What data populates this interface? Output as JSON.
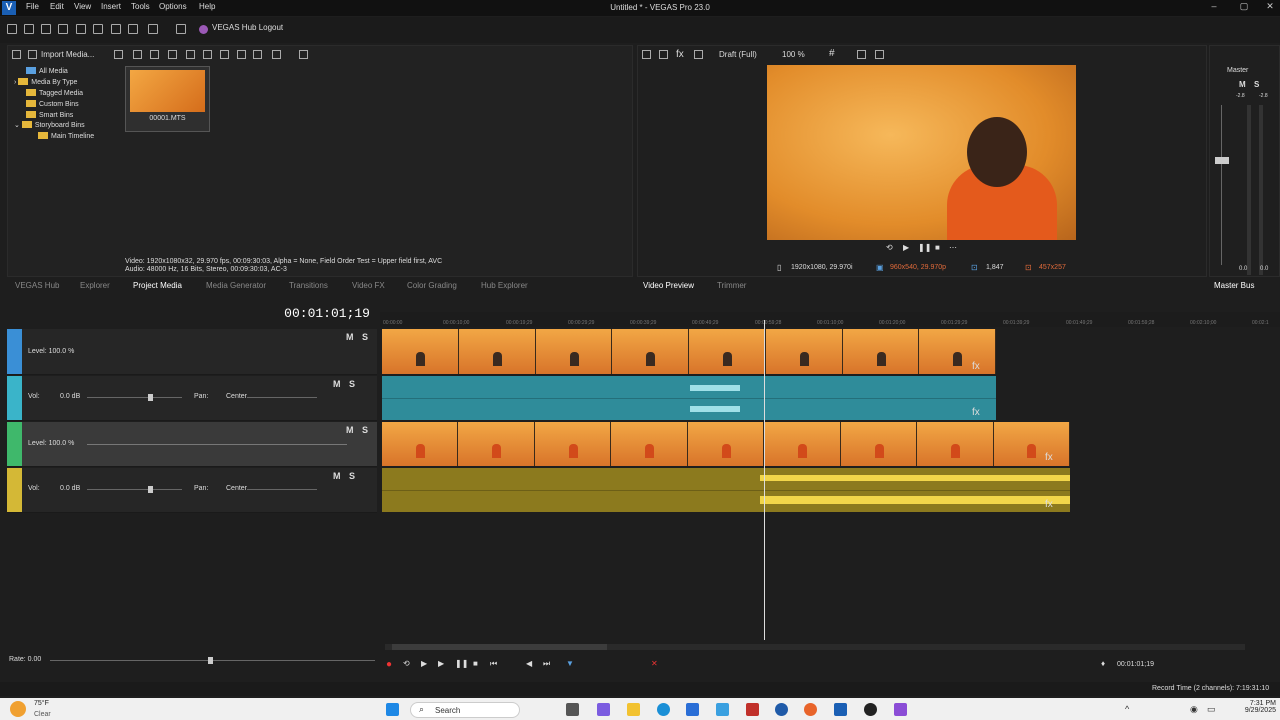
{
  "app": {
    "title": "Untitled * - VEGAS Pro 23.0",
    "logo": "V"
  },
  "menu": [
    "File",
    "Edit",
    "View",
    "Insert",
    "Tools",
    "Options",
    "Help"
  ],
  "toolbar": {
    "hub_label": "VEGAS Hub Logout"
  },
  "media_panel": {
    "import_label": "Import Media...",
    "tree": [
      "All Media",
      "Media By Type",
      "Tagged Media",
      "Custom Bins",
      "Smart Bins",
      "Storyboard Bins",
      "Main Timeline"
    ],
    "thumb_label": "00001.MTS",
    "info_video": "Video: 1920x1080x32, 29.970 fps, 00:09:30:03, Alpha = None, Field Order Test = Upper field first, AVC",
    "info_audio": "Audio: 48000 Hz, 16 Bits, Stereo, 00:09:30:03, AC-3"
  },
  "left_tabs": [
    "VEGAS Hub",
    "Explorer",
    "Project Media",
    "Media Generator",
    "Transitions",
    "Video FX",
    "Color Grading",
    "Hub Explorer"
  ],
  "preview": {
    "quality": "Draft (Full)",
    "zoom": "100 %",
    "project_res": "1920x1080, 29.970i",
    "preview_res": "960x540, 29.970p",
    "frame": "1,847",
    "display": "457x257",
    "tabs": [
      "Video Preview",
      "Trimmer"
    ]
  },
  "master": {
    "label": "Master",
    "tab": "Master Bus",
    "m": "M",
    "s": "S",
    "db_left": "-2.8",
    "db_right": "-2.8",
    "meter_vals": [
      "0.0",
      "0.0"
    ]
  },
  "timeline": {
    "timecode": "00:01:01;19",
    "ruler": [
      "00:00:00",
      "00:00:10;00",
      "00:00:19;29",
      "00:00:29;29",
      "00:00:39;29",
      "00:00:49;29",
      "00:00:59;28",
      "00:01:10;00",
      "00:01:20;00",
      "00:01:29;29",
      "00:01:39;29",
      "00:01:49;29",
      "00:01:59;28",
      "00:02:10;00",
      "00:02:1"
    ],
    "tracks": [
      {
        "type": "video",
        "level": "Level: 100.0 %",
        "color": "#3a8fd6"
      },
      {
        "type": "audio",
        "vol_label": "Vol:",
        "vol": "0.0 dB",
        "pan_label": "Pan:",
        "pan": "Center",
        "color": "#3ab4c9"
      },
      {
        "type": "video",
        "level": "Level: 100.0 %",
        "color": "#3fb86b"
      },
      {
        "type": "audio",
        "vol_label": "Vol:",
        "vol": "0.0 dB",
        "pan_label": "Pan:",
        "pan": "Center",
        "color": "#d4b836"
      }
    ],
    "rate": "Rate: 0.00",
    "cursor_time": "00:01:01;19",
    "record_time": "Record Time (2 channels): 7:19:31:10"
  },
  "taskbar": {
    "weather_temp": "75°F",
    "weather_desc": "Clear",
    "search": "Search",
    "time": "7:31 PM",
    "date": "9/29/2025"
  }
}
